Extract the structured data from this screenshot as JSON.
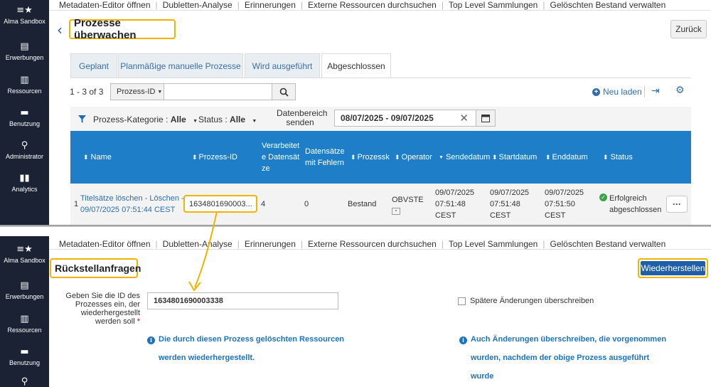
{
  "sidebar": {
    "institution": "Alma Sandbox",
    "items": [
      "Erwerbungen",
      "Ressourcen",
      "Benutzung",
      "Administrator",
      "Analytics"
    ]
  },
  "topnav": [
    "Metadaten-Editor öffnen",
    "Dubletten-Analyse",
    "Erinnerungen",
    "Externe Ressourcen durchsuchen",
    "Top Level Sammlungen",
    "Gelöschten Bestand verwalten"
  ],
  "top": {
    "title": "Prozesse überwachen",
    "back_label": "Zurück",
    "tabs": [
      "Geplant",
      "Planmäßige manuelle Prozesse",
      "Wird ausgeführt",
      "Abgeschlossen"
    ],
    "results": "1 - 3 of 3",
    "search_scope": "Prozess-ID",
    "reload_label": "Neu laden",
    "filters": {
      "category_label": "Prozess-Kategorie :",
      "category_value": "Alle",
      "status_label": "Status :",
      "status_value": "Alle",
      "date_label_1": "Datenbereich",
      "date_label_2": "senden",
      "date_value": "08/07/2025 - 09/07/2025"
    },
    "columns": {
      "name": "Name",
      "id": "Prozess-ID",
      "processed": "Verarbeitete Datensätze",
      "errors": "Datensätze mit Fehlern",
      "process": "Prozessk",
      "operator": "Operator",
      "send": "Sendedatum",
      "start": "Startdatum",
      "end": "Enddatum",
      "status": "Status"
    },
    "row": {
      "index": "1",
      "name_line1": "Titelsätze löschen - Löschen -",
      "name_line2": "09/07/2025 07:51:44 CEST",
      "id": "1634801690003...",
      "processed": "4",
      "errors": "0",
      "process": "Bestand",
      "operator": "OBVSTE",
      "send_date": "09/07/2025",
      "send_time": "07:51:48",
      "send_tz": "CEST",
      "start_date": "09/07/2025",
      "start_time": "07:51:48",
      "start_tz": "CEST",
      "end_date": "09/07/2025",
      "end_time": "07:51:50",
      "end_tz": "CEST",
      "status_line1": "Erfolgreich",
      "status_line2": "abgeschlossen",
      "more": "···"
    }
  },
  "bottom": {
    "title": "Rückstellanfragen",
    "restore_label": "Wiederherstellen",
    "field_label_1": "Geben Sie die ID des",
    "field_label_2": "Prozesses ein, der",
    "field_label_3": "wiederhergestellt",
    "field_label_4": "werden soll",
    "required_mark": "*",
    "id_value": "1634801690003338",
    "overwrite_label": "Spätere Änderungen überschreiben",
    "info1_line1": "Die durch diesen Prozess gelöschten Ressourcen",
    "info1_line2": "werden wiederhergestellt.",
    "info2_line1": "Auch Änderungen überschreiben, die vorgenommen",
    "info2_line2": "wurden, nachdem der obige Prozess ausgeführt",
    "info2_line3": "wurde"
  },
  "colors": {
    "highlight": "#f0b400",
    "sidebar": "#1a2233",
    "table_header": "#1e7ec8",
    "link": "#2e6fb0",
    "primary": "#1e5fa8"
  }
}
